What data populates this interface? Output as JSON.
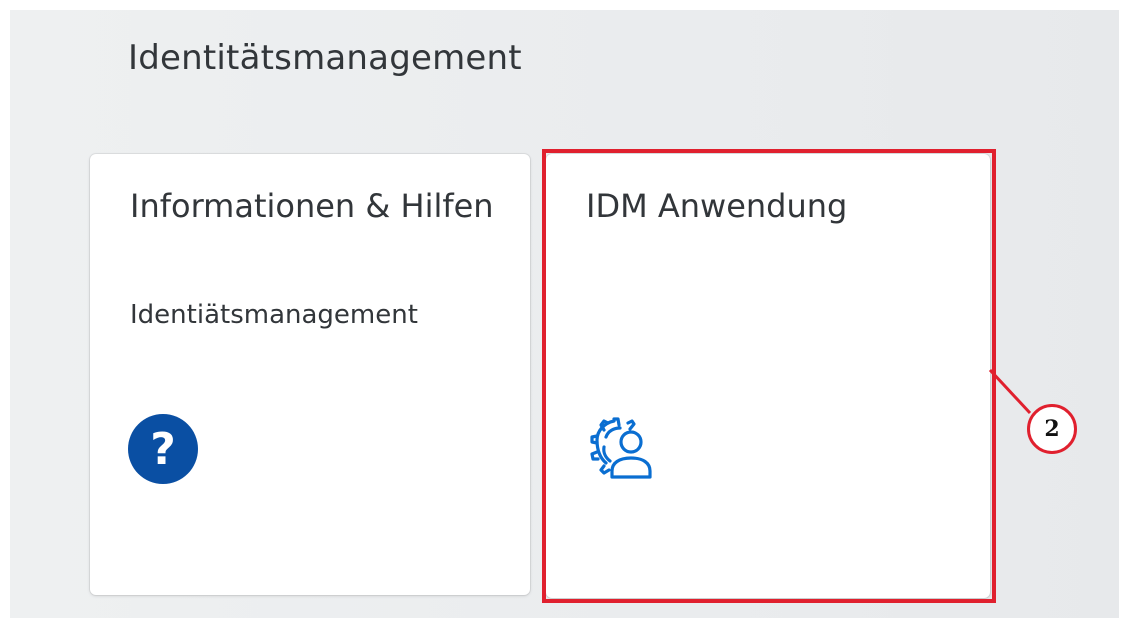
{
  "group": {
    "title": "Identitätsmanagement"
  },
  "tiles": [
    {
      "title": "Informationen & Hilfen",
      "subtitle": "Identiätsmanagement",
      "icon": "question-circle-icon",
      "icon_color": "#0a4fa3"
    },
    {
      "title": "IDM Anwendung",
      "subtitle": "",
      "icon": "user-settings-icon",
      "icon_color": "#0a6ed1"
    }
  ],
  "annotation": {
    "step_number": "2",
    "highlight_color": "#e0202e"
  }
}
